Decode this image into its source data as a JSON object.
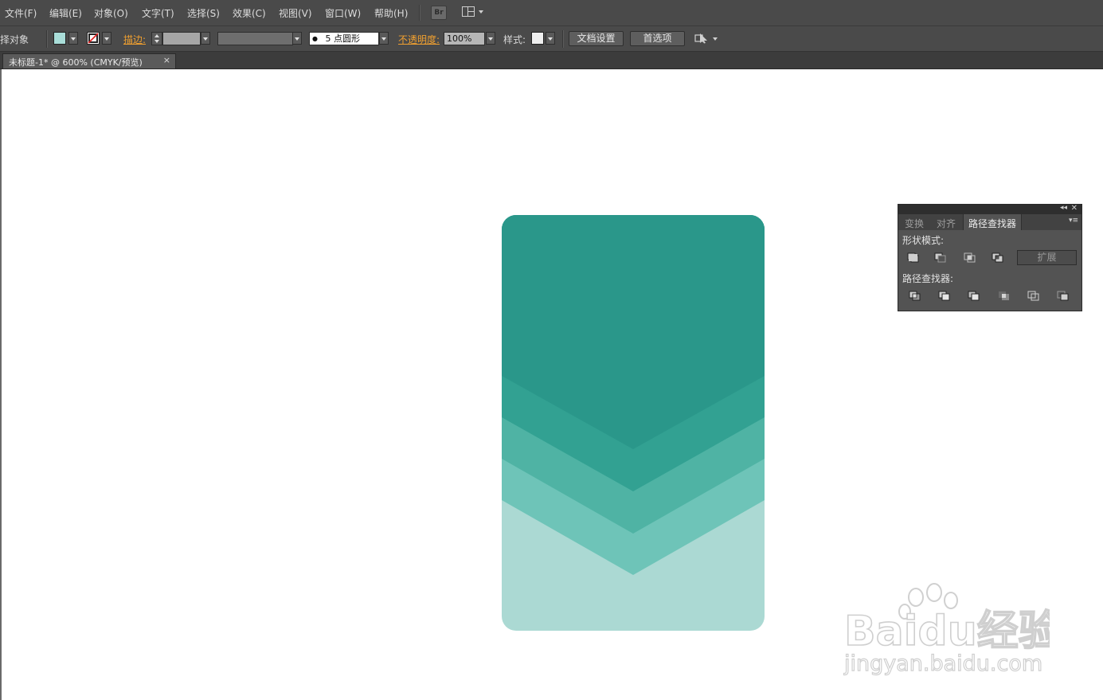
{
  "menubar": {
    "items": [
      {
        "label": "文件(F)"
      },
      {
        "label": "编辑(E)"
      },
      {
        "label": "对象(O)"
      },
      {
        "label": "文字(T)"
      },
      {
        "label": "选择(S)"
      },
      {
        "label": "效果(C)"
      },
      {
        "label": "视图(V)"
      },
      {
        "label": "窗口(W)"
      },
      {
        "label": "帮助(H)"
      }
    ],
    "bridge_label": "Br",
    "workspace_icon": "workspace-layout-icon"
  },
  "controlbar": {
    "selection_label": "择对象",
    "fill_color": "#a9ddd8",
    "stroke_none_icon": "no-stroke-icon",
    "stroke_label": "描边:",
    "stroke_weight_value": "",
    "variable_width_value": "",
    "brush_value": "5 点圆形",
    "opacity_label": "不透明度:",
    "opacity_value": "100%",
    "style_label": "样式:",
    "doc_setup_label": "文档设置",
    "preferences_label": "首选项"
  },
  "document": {
    "tab_title": "未标题-1* @ 600% (CMYK/预览)",
    "tab_close": "×"
  },
  "artwork": {
    "colors": [
      "#2a978a",
      "#32a192",
      "#4fb3a4",
      "#6ec4b8",
      "#abd9d3"
    ]
  },
  "pathfinder_panel": {
    "tabs": [
      {
        "label": "变换"
      },
      {
        "label": "对齐"
      },
      {
        "label": "路径查找器"
      }
    ],
    "active_tab": "路径查找器",
    "shape_modes_label": "形状模式:",
    "shape_mode_icons": [
      "unite-icon",
      "minus-front-icon",
      "intersect-icon",
      "exclude-icon"
    ],
    "expand_label": "扩展",
    "pathfinders_label": "路径查找器:",
    "pathfinder_icons": [
      "divide-icon",
      "trim-icon",
      "merge-icon",
      "crop-icon",
      "outline-icon",
      "minus-back-icon"
    ]
  },
  "watermark": {
    "brand": "Baidu经验",
    "url": "jingyan.baidu.com"
  }
}
